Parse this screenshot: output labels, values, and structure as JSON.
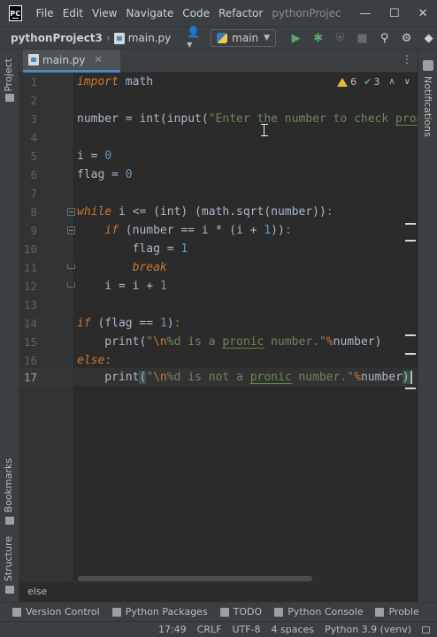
{
  "app": {
    "logo_text": "PC"
  },
  "menu": {
    "items": [
      "File",
      "Edit",
      "View",
      "Navigate",
      "Code",
      "Refactor"
    ],
    "project_title": "pythonProjec"
  },
  "window_controls": {
    "minimize": "—",
    "maximize": "☐",
    "close": "✕"
  },
  "navbar": {
    "project": "pythonProject3",
    "file": "main.py",
    "user_icon": "👤▾",
    "run_config": "main"
  },
  "toolbar_icons": [
    "run-icon",
    "debug-icon",
    "coverage-icon",
    "stop-icon",
    "search-icon",
    "settings-icon",
    "plugins-icon"
  ],
  "left_tabs": {
    "project": "Project",
    "bookmarks": "Bookmarks",
    "structure": "Structure"
  },
  "right_tabs": {
    "notifications": "Notifications"
  },
  "editor_tab": {
    "label": "main.py",
    "close": "✕"
  },
  "inspections": {
    "warnings": "6",
    "ok": "3"
  },
  "code": {
    "line_numbers": [
      "1",
      "2",
      "3",
      "4",
      "5",
      "6",
      "7",
      "8",
      "9",
      "10",
      "11",
      "12",
      "13",
      "14",
      "15",
      "16",
      "17"
    ],
    "current_line": "17"
  },
  "breadcrumb": "else",
  "tool_windows": [
    "Version Control",
    "Python Packages",
    "TODO",
    "Python Console",
    "Proble"
  ],
  "status_bar": {
    "position": "17:49",
    "line_sep": "CRLF",
    "encoding": "UTF-8",
    "indent": "4 spaces",
    "interpreter": "Python 3.9 (venv)"
  },
  "colors": {
    "keyword": "#cc7832",
    "number": "#6897bb",
    "string": "#6a8759",
    "text": "#a9b7c6",
    "background": "#2b2b2b",
    "chrome": "#3c3f41"
  }
}
